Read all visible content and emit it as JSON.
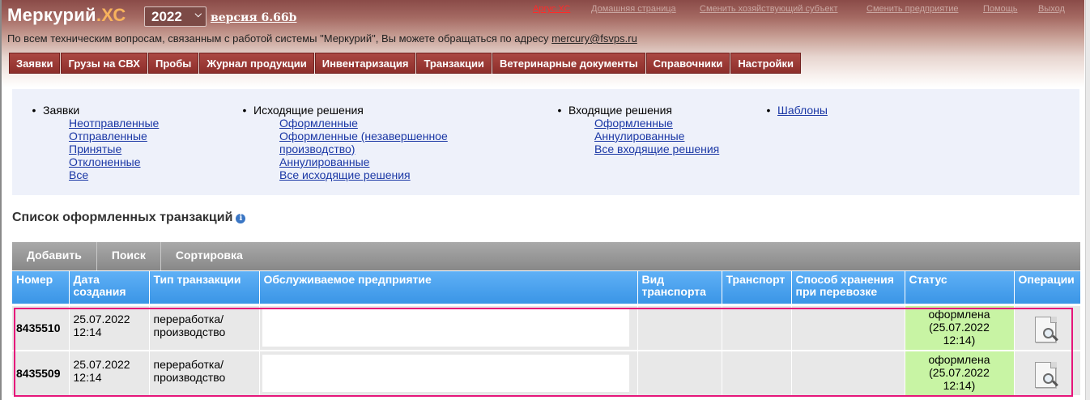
{
  "header": {
    "app_name": "Меркурий",
    "app_suffix": ".ХС",
    "year": "2022",
    "version": "версия 6.66b",
    "support_text": "По всем техническим вопросам, связанным с работой системы \"Меркурий\", Вы можете обращаться по адресу ",
    "support_email": "mercury@fsvps.ru",
    "top_links": [
      "Аргус.ХС",
      "Домашняя страница",
      "Сменить хозяйствующий субъект",
      "Сменить предприятие",
      "Помощь",
      "Выход"
    ]
  },
  "nav": [
    "Заявки",
    "Грузы на СВХ",
    "Пробы",
    "Журнал продукции",
    "Инвентаризация",
    "Транзакции",
    "Ветеринарные документы",
    "Справочники",
    "Настройки"
  ],
  "submenu": {
    "requests": {
      "title": "Заявки",
      "items": [
        "Неотправленные",
        "Отправленные",
        "Принятые",
        "Отклоненные",
        "Все"
      ]
    },
    "outgoing": {
      "title": "Исходящие решения",
      "items": [
        "Оформленные",
        "Оформленные (незавершенное",
        "производство)",
        "Аннулированные",
        "Все исходящие решения"
      ]
    },
    "incoming": {
      "title": "Входящие решения",
      "items": [
        "Оформленные",
        "Аннулированные",
        "Все входящие решения"
      ]
    },
    "templates": "Шаблоны"
  },
  "page_title": "Список оформленных транзакций",
  "toolbar": [
    "Добавить",
    "Поиск",
    "Сортировка"
  ],
  "table": {
    "columns": {
      "number": "Номер",
      "date1": "Дата",
      "date2": "создания",
      "type": "Тип транзакции",
      "org": "Обслуживаемое предприятие",
      "vid1": "Вид",
      "vid2": "транспорта",
      "transport": "Транспорт",
      "storage1": "Способ хранения",
      "storage2": "при перевозке",
      "status": "Статус",
      "ops": "Операции"
    },
    "rows": [
      {
        "number": "8435510",
        "date": "25.07.2022",
        "time": "12:14",
        "type1": "переработка/",
        "type2": "производство",
        "org": "",
        "vid": "",
        "transport": "",
        "storage": "",
        "status1": "оформлена",
        "status2": "(25.07.2022",
        "status3": "12:14)"
      },
      {
        "number": "8435509",
        "date": "25.07.2022",
        "time": "12:14",
        "type1": "переработка/",
        "type2": "производство",
        "org": "",
        "vid": "",
        "transport": "",
        "storage": "",
        "status1": "оформлена",
        "status2": "(25.07.2022",
        "status3": "12:14)"
      }
    ]
  }
}
